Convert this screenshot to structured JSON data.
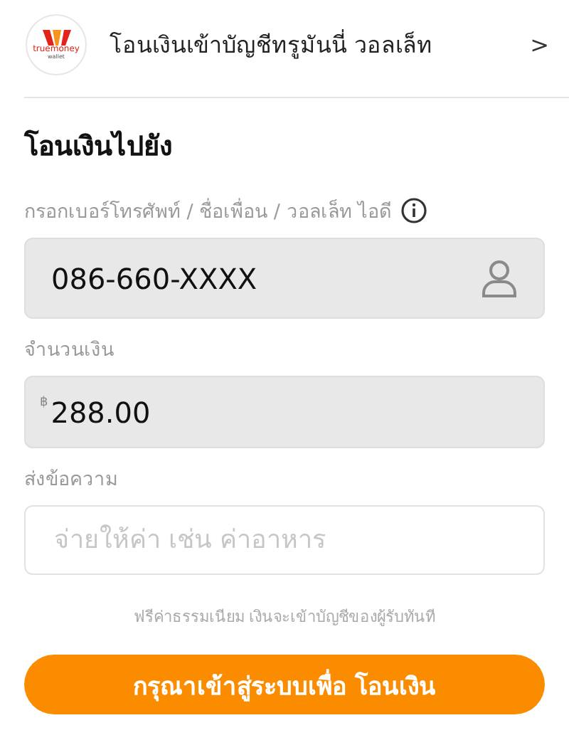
{
  "header": {
    "logo_text": "truemoney",
    "logo_subtext": "wallet",
    "title": "โอนเงินเข้าบัญชีทรูมันนี่ วอลเล็ท",
    "chevron": ">"
  },
  "section_title": "โอนเงินไปยัง",
  "fields": [
    {
      "kind": "recipient",
      "label": "กรอกเบอร์โทรศัพท์ / ชื่อเพื่อน / วอลเล็ท ไอดี",
      "value": "086-660-XXXX",
      "filled": true
    },
    {
      "kind": "amount",
      "label": "จำนวนเงิน",
      "currency": "฿",
      "value": "288.00",
      "filled": true
    },
    {
      "kind": "message",
      "label": "ส่งข้อความ",
      "placeholder": "จ่ายให้ค่า เช่น ค่าอาหาร",
      "filled": false
    }
  ],
  "note": "ฟรีค่าธรรมเนียม เงินจะเข้าบัญชีของผู้รับทันที",
  "button": "กรุณาเข้าสู่ระบบเพื่อ โอนเงิน"
}
